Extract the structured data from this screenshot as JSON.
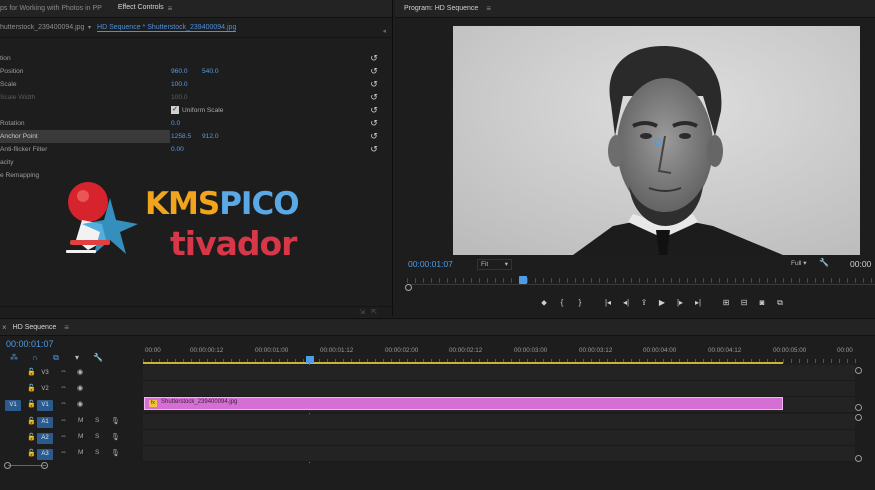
{
  "effect_controls": {
    "tabs": [
      {
        "label": "ps for Working with Photos in PP"
      },
      {
        "label": "Effect Controls"
      }
    ],
    "source_clip": "hutterstock_239400094.jpg",
    "sequence_clip": "HD Sequence * Shutterstock_239400094.jpg",
    "properties": [
      {
        "name": "tion",
        "v1": "",
        "v2": ""
      },
      {
        "name": "Position",
        "v1": "960.0",
        "v2": "540.0"
      },
      {
        "name": "Scale",
        "v1": "100.0",
        "v2": ""
      },
      {
        "name": "Scale Width",
        "v1": "100.0",
        "v2": ""
      },
      {
        "name": "",
        "v1": "Uniform Scale",
        "v2": ""
      },
      {
        "name": "Rotation",
        "v1": "0.0",
        "v2": ""
      },
      {
        "name": "Anchor Point",
        "v1": "1258.5",
        "v2": "912.0"
      },
      {
        "name": "Anti-flicker Filter",
        "v1": "0.00",
        "v2": ""
      },
      {
        "name": "acity",
        "v1": "",
        "v2": ""
      },
      {
        "name": "e Remapping",
        "v1": "",
        "v2": ""
      }
    ]
  },
  "watermark": {
    "line1_a": "KMS",
    "line1_b": "PICO",
    "line2": "tivador"
  },
  "program_monitor": {
    "title": "Program: HD Sequence",
    "timecode": "00:00:01:07",
    "fit": "Fit",
    "resolution": "Full",
    "duration": "00:00"
  },
  "timeline": {
    "title": "HD Sequence",
    "timecode": "00:00:01:07",
    "ruler": [
      "00:00",
      "00:00:00:12",
      "00:00:01:00",
      "00:00:01:12",
      "00:00:02:00",
      "00:00:02:12",
      "00:00:03:00",
      "00:00:03:12",
      "00:00:04:00",
      "00:00:04:12",
      "00:00:05:00",
      "00:00"
    ],
    "tracks": [
      {
        "label": "V3",
        "type": "video"
      },
      {
        "label": "V2",
        "type": "video"
      },
      {
        "label": "V1",
        "type": "video",
        "source": "V1"
      },
      {
        "label": "A1",
        "type": "audio"
      },
      {
        "label": "A2",
        "type": "audio"
      },
      {
        "label": "A3",
        "type": "audio"
      }
    ],
    "clip_name": "Shutterstock_239400094.jpg",
    "clip_color": "#d56fd3"
  }
}
